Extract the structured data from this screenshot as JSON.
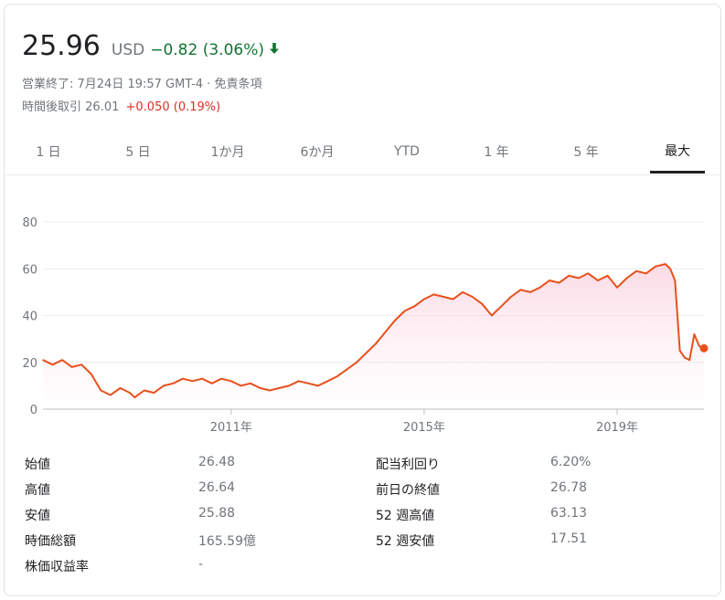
{
  "quote": {
    "price": "25.96",
    "currency": "USD",
    "change": "−0.82 (3.06%)",
    "change_color": "#137333",
    "direction_icon": "arrow-down-icon",
    "market_status": "営業終了: 7月24日 19:57 GMT-4 · 免責条項",
    "after_hours_label": "時間後取引",
    "after_hours_price": "26.01",
    "after_hours_change": "+0.050 (0.19%)",
    "after_hours_color": "#d93025"
  },
  "tabs": [
    {
      "label": "1 日",
      "active": false
    },
    {
      "label": "5 日",
      "active": false
    },
    {
      "label": "1か月",
      "active": false
    },
    {
      "label": "6か月",
      "active": false
    },
    {
      "label": "YTD",
      "active": false
    },
    {
      "label": "1 年",
      "active": false
    },
    {
      "label": "5 年",
      "active": false
    },
    {
      "label": "最大",
      "active": true
    }
  ],
  "chart_data": {
    "type": "area",
    "line_color": "#e8501b",
    "fill_color": "#fce4ec",
    "xlabel": "",
    "ylabel": "",
    "ylim": [
      0,
      80
    ],
    "xlim": [
      2007.1,
      2020.8
    ],
    "y_ticks": [
      0,
      20,
      40,
      60,
      80
    ],
    "x_ticks": [
      {
        "value": 2011,
        "label": "2011年"
      },
      {
        "value": 2015,
        "label": "2015年"
      },
      {
        "value": 2019,
        "label": "2019年"
      }
    ],
    "grid": true,
    "series": [
      {
        "x": [
          2007.1,
          2007.3,
          2007.5,
          2007.7,
          2007.9,
          2008.1,
          2008.3,
          2008.5,
          2008.7,
          2008.9,
          2009.0,
          2009.2,
          2009.4,
          2009.6,
          2009.8,
          2010.0,
          2010.2,
          2010.4,
          2010.6,
          2010.8,
          2011.0,
          2011.2,
          2011.4,
          2011.6,
          2011.8,
          2012.0,
          2012.2,
          2012.4,
          2012.6,
          2012.8,
          2013.0,
          2013.2,
          2013.4,
          2013.6,
          2013.8,
          2014.0,
          2014.2,
          2014.4,
          2014.6,
          2014.8,
          2015.0,
          2015.2,
          2015.4,
          2015.6,
          2015.8,
          2016.0,
          2016.2,
          2016.4,
          2016.6,
          2016.8,
          2017.0,
          2017.2,
          2017.4,
          2017.6,
          2017.8,
          2018.0,
          2018.2,
          2018.4,
          2018.6,
          2018.8,
          2019.0,
          2019.2,
          2019.4,
          2019.6,
          2019.8,
          2020.0,
          2020.1,
          2020.2,
          2020.3,
          2020.4,
          2020.5,
          2020.6,
          2020.7,
          2020.8
        ],
        "values": [
          21,
          19,
          21,
          18,
          19,
          15,
          8,
          6,
          9,
          7,
          5,
          8,
          7,
          10,
          11,
          13,
          12,
          13,
          11,
          13,
          12,
          10,
          11,
          9,
          8,
          9,
          10,
          12,
          11,
          10,
          12,
          14,
          17,
          20,
          24,
          28,
          33,
          38,
          42,
          44,
          47,
          49,
          48,
          47,
          50,
          48,
          45,
          40,
          44,
          48,
          51,
          50,
          52,
          55,
          54,
          57,
          56,
          58,
          55,
          57,
          52,
          56,
          59,
          58,
          61,
          62,
          60,
          55,
          25,
          22,
          21,
          32,
          27,
          26
        ]
      }
    ]
  },
  "stats": [
    {
      "label": "始値",
      "value": "26.48",
      "label2": "配当利回り",
      "value2": "6.20%"
    },
    {
      "label": "高値",
      "value": "26.64",
      "label2": "前日の終値",
      "value2": "26.78"
    },
    {
      "label": "安値",
      "value": "25.88",
      "label2": "52 週高値",
      "value2": "63.13"
    },
    {
      "label": "時価総額",
      "value": "165.59億",
      "label2": "52 週安値",
      "value2": "17.51"
    },
    {
      "label": "株価収益率",
      "value": "-",
      "label2": "",
      "value2": ""
    }
  ]
}
